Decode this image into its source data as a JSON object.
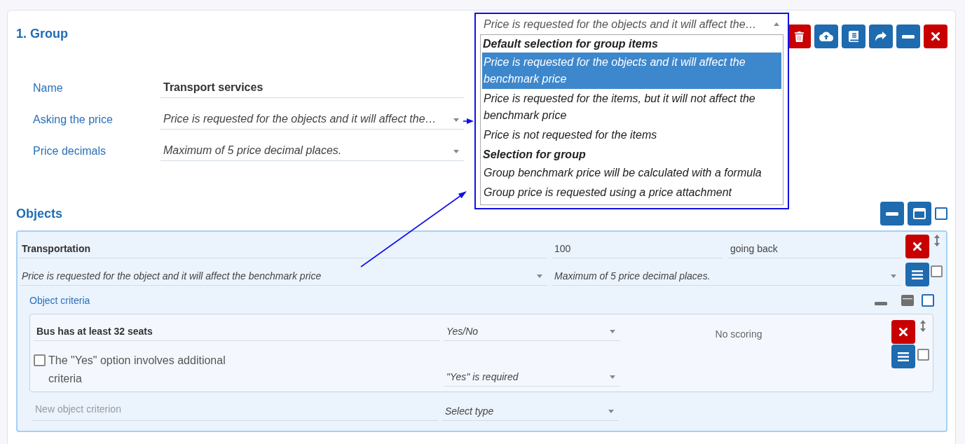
{
  "group": {
    "title": "1. Group",
    "fields": [
      {
        "label": "Name",
        "kind": "text",
        "value": "Transport services"
      },
      {
        "label": "Asking the price",
        "kind": "select",
        "value": "Price is requested for the objects and it will affect the…"
      },
      {
        "label": "Price decimals",
        "kind": "select",
        "value": "Maximum of 5 price decimal places."
      }
    ]
  },
  "dropdown_callout": {
    "value": "Price is requested for the objects and it will affect the…",
    "expanded": true,
    "groups": [
      {
        "label": "Default selection for group items",
        "options": [
          {
            "label": "Price is requested for the objects and it will affect the benchmark price",
            "selected": true
          },
          {
            "label": "Price is requested for the items, but it will not affect the benchmark price",
            "selected": false
          },
          {
            "label": "Price is not requested for the items",
            "selected": false
          }
        ]
      },
      {
        "label": "Selection for group",
        "options": [
          {
            "label": "Group benchmark price will be calculated with a formula",
            "selected": false
          },
          {
            "label": "Group price is requested using a price attachment",
            "selected": false
          }
        ]
      }
    ]
  },
  "objects": {
    "title": "Objects",
    "checked": false,
    "items": [
      {
        "name": "Transportation",
        "field_2": "100",
        "field_3": "going back",
        "asking_price": "Price is requested for the object and it will affect the benchmark price",
        "price_decimals": "Maximum of 5 price decimal places.",
        "checked": false,
        "criteria_title": "Object criteria",
        "criteria_checked": false,
        "criteria": [
          {
            "name": "Bus has at least 32 seats",
            "type": "Yes/No",
            "scoring": "No scoring",
            "checked": false,
            "option": {
              "label": "The \"Yes\" option involves additional criteria",
              "checked": false
            },
            "requirement": "\"Yes\" is required"
          }
        ],
        "new_criterion": {
          "placeholder": "New object criterion",
          "type": "Select type"
        }
      }
    ]
  }
}
